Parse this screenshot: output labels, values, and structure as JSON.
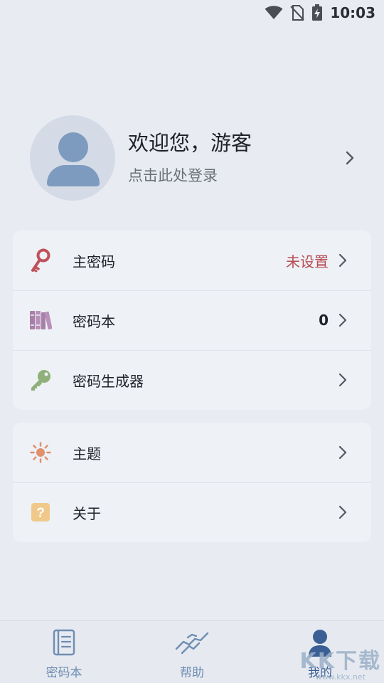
{
  "status_bar": {
    "time": "10:03",
    "icons": [
      "wifi-icon",
      "no-sim-icon",
      "battery-charging-icon"
    ]
  },
  "profile": {
    "welcome": "欢迎您，游客",
    "login_hint": "点击此处登录"
  },
  "menu_main": [
    {
      "label": "主密码",
      "value": "未设置",
      "icon": "key-icon",
      "icon_color": "#c0505a"
    },
    {
      "label": "密码本",
      "value": "0",
      "icon": "books-icon",
      "icon_color": "#a77fa8"
    },
    {
      "label": "密码生成器",
      "value": "",
      "icon": "key-solid-icon",
      "icon_color": "#8fb07a"
    }
  ],
  "menu_other": [
    {
      "label": "主题",
      "icon": "sun-icon",
      "icon_color": "#e0906a"
    },
    {
      "label": "关于",
      "icon": "question-icon",
      "icon_color": "#f0c98a"
    }
  ],
  "bottom_nav": [
    {
      "label": "密码本",
      "icon": "notebook-icon",
      "active": false
    },
    {
      "label": "帮助",
      "icon": "handshake-icon",
      "active": false
    },
    {
      "label": "我的",
      "icon": "person-icon",
      "active": true
    }
  ],
  "watermark": {
    "big": "KK下载",
    "small": "www.kkx.net"
  },
  "colors": {
    "background": "#e8ecf2",
    "card": "#eef1f6",
    "accent": "#3a5f94",
    "nav_inactive": "#6f8db3",
    "warning_text": "#b84a52"
  }
}
